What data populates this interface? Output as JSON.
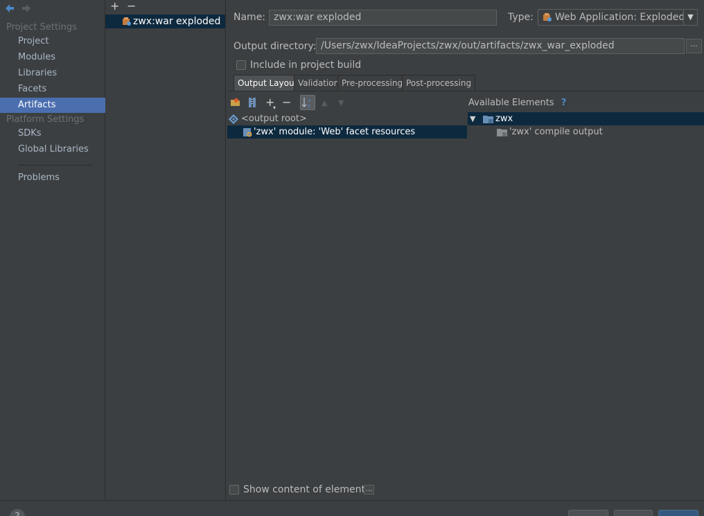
{
  "nav": {
    "back_icon": "back-arrow-icon",
    "forward_icon": "forward-arrow-icon",
    "project_settings_header": "Project Settings",
    "project_items": [
      "Project",
      "Modules",
      "Libraries",
      "Facets",
      "Artifacts"
    ],
    "platform_settings_header": "Platform Settings",
    "platform_items": [
      "SDKs",
      "Global Libraries"
    ],
    "problems": "Problems",
    "selected_item": "Artifacts"
  },
  "artifacts": {
    "add": "+",
    "remove": "−",
    "items": [
      "zwx:war exploded"
    ]
  },
  "form": {
    "name_label": "Name:",
    "name_value": "zwx:war exploded",
    "type_label": "Type:",
    "type_value": "Web Application: Exploded",
    "output_dir_label": "Output directory:",
    "output_dir_value": "/Users/zwx/IdeaProjects/zwx/out/artifacts/zwx_war_exploded",
    "browse": "...",
    "include_in_build": "Include in project build",
    "include_in_build_checked": false
  },
  "tabs": [
    "Output Layout",
    "Validation",
    "Pre-processing",
    "Post-processing"
  ],
  "active_tab": "Output Layout",
  "layout": {
    "toolbar_plus": "+",
    "toolbar_minus": "−",
    "root": "<output root>",
    "children": [
      "'zwx' module: 'Web' facet resources"
    ]
  },
  "available": {
    "header": "Available Elements",
    "help": "?",
    "module": "zwx",
    "children": [
      "'zwx' compile output"
    ]
  },
  "show_content": "Show content of elements",
  "show_content_button": "...",
  "colors": {
    "selection": "#4b6eaf",
    "tree_selection": "#0d293e",
    "background": "#3c3f41"
  }
}
